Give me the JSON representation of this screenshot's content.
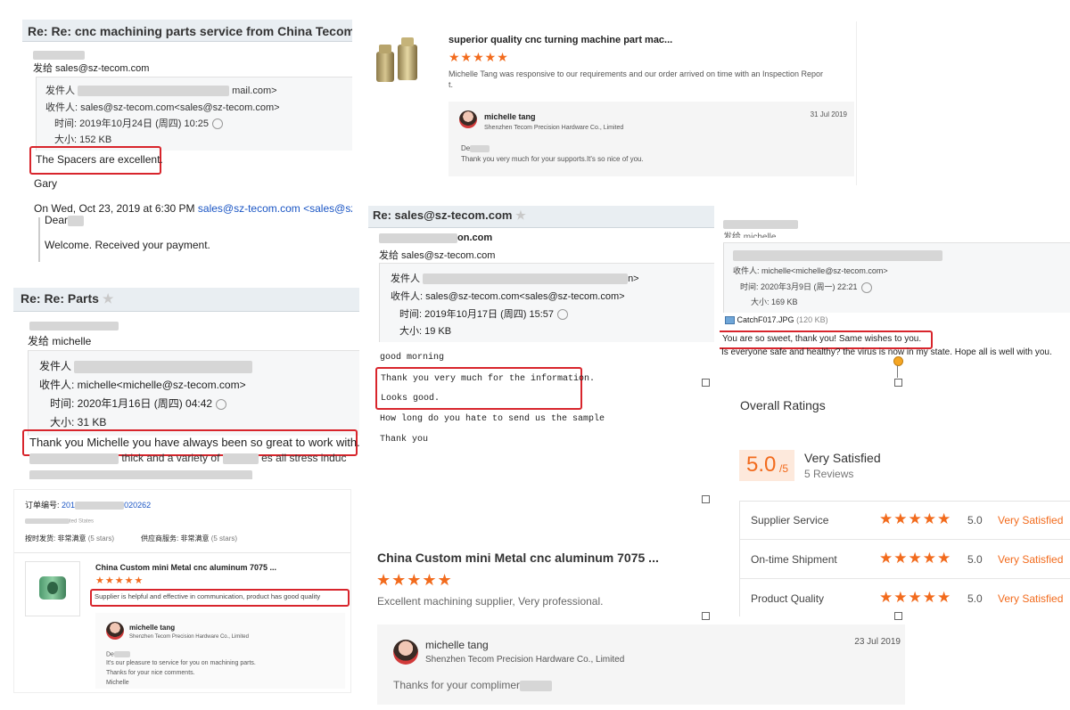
{
  "p1": {
    "subject": "Re: Re: cnc machining parts service from China Tecom Precisio",
    "to_line": "发给 sales@sz-tecom.com",
    "from_label": "发件人",
    "from_tail": "mail.com>",
    "recipient": "收件人: sales@sz-tecom.com<sales@sz-tecom.com>",
    "time": "时间: 2019年10月24日 (周四) 10:25",
    "size": "大小: 152 KB",
    "highlight": "The Spacers are excellent.",
    "signature": "Gary",
    "quote_intro": "On Wed, Oct 23, 2019 at 6:30 PM",
    "quote_email": "sales@sz-tecom.com",
    "quote_email2": "<sales@sz-tecom",
    "dear": "Dear",
    "welcome": "Welcome. Received your payment."
  },
  "p2": {
    "title": "superior quality cnc turning machine part mac...",
    "review": "Michelle Tang was responsive to our requirements and our order arrived on time with an Inspection Repor",
    "review_tail": "t.",
    "reply_name": "michelle tang",
    "reply_company": "Shenzhen Tecom Precision Hardware Co., Limited",
    "reply_date": "31 Jul 2019",
    "reply_dear": "De",
    "reply_text": "Thank you very much for your supports.It's so nice of you."
  },
  "p3": {
    "subject": "Re: Re: Parts",
    "to_line": "发给 michelle",
    "from_label": "发件人",
    "recipient": "收件人: michelle<michelle@sz-tecom.com>",
    "time": "时间: 2020年1月16日 (周四) 04:42",
    "size": "大小: 31 KB",
    "highlight": "Thank you Michelle you have always been so great to work with.",
    "line2": "thick and a variety of",
    "line2b": "es all stress induc"
  },
  "p4": {
    "subject": "Re: sales@sz-tecom.com",
    "first_tail": "on.com",
    "to_line": "发给 sales@sz-tecom.com",
    "from_label": "发件人",
    "from_tail": "n>",
    "recipient": "收件人: sales@sz-tecom.com<sales@sz-tecom.com>",
    "time": "时间: 2019年10月17日 (周四) 15:57",
    "size": "大小: 19 KB",
    "greeting": "good morning",
    "hl1": "Thank you very much for the information.",
    "hl2": "Looks good.",
    "question": "How long do you hate to send us the sample",
    "thanks": "Thank you"
  },
  "p5": {
    "to_line": "发给 michelle",
    "recipient": "收件人: michelle<michelle@sz-tecom.com>",
    "time": "时间: 2020年3月9日 (周一) 22:21",
    "size": "大小: 169 KB",
    "attachment": "CatchF017.JPG",
    "attachment_size": "(120 KB)",
    "highlight": "You are so sweet, thank you! Same wishes to you.",
    "line2": "Is everyone  safe and healthy? the virus is now in my state.  Hope all is well with you."
  },
  "p6": {
    "order_label": "订单编号:",
    "order_no_a": "201",
    "order_no_b": "020262",
    "country_tail": "ted States",
    "ship_label": "按时发货: 非常满意",
    "ship_stars": "(5 stars)",
    "service_label": "供应商服务: 非常满意",
    "service_stars": "(5 stars)",
    "product_title": "China Custom mini Metal cnc aluminum 7075 ...",
    "highlight": "Supplier is helpful and effective in communication, product has good quality",
    "reply_name": "michelle tang",
    "reply_company": "Shenzhen Tecom Precision Hardware Co., Limited",
    "reply_dear": "De",
    "reply_l1": "It's our pleasure to service for you on machining parts.",
    "reply_l2": "Thanks for your nice comments.",
    "reply_l3": "Michelle"
  },
  "p7": {
    "title": "China Custom mini Metal cnc aluminum 7075 ...",
    "review": "Excellent machining supplier, Very professional.",
    "reply_name": "michelle tang",
    "reply_company": "Shenzhen Tecom Precision Hardware Co., Limited",
    "reply_date": "23 Jul 2019",
    "reply_text": "Thanks for your complimer"
  },
  "p8": {
    "heading": "Overall Ratings",
    "score": "5.0",
    "score_denom": "/5",
    "label": "Very Satisfied",
    "reviews": "5 Reviews",
    "rows": [
      {
        "name": "Supplier Service",
        "value": "5.0",
        "verdict": "Very Satisfied"
      },
      {
        "name": "On-time Shipment",
        "value": "5.0",
        "verdict": "Very Satisfied"
      },
      {
        "name": "Product Quality",
        "value": "5.0",
        "verdict": "Very Satisfied"
      }
    ]
  },
  "icons": {
    "star": "★",
    "clock": "clock-icon"
  },
  "colors": {
    "accent_orange": "#f26b1d",
    "highlight_red": "#d8252c",
    "link_blue": "#1a55c4"
  }
}
